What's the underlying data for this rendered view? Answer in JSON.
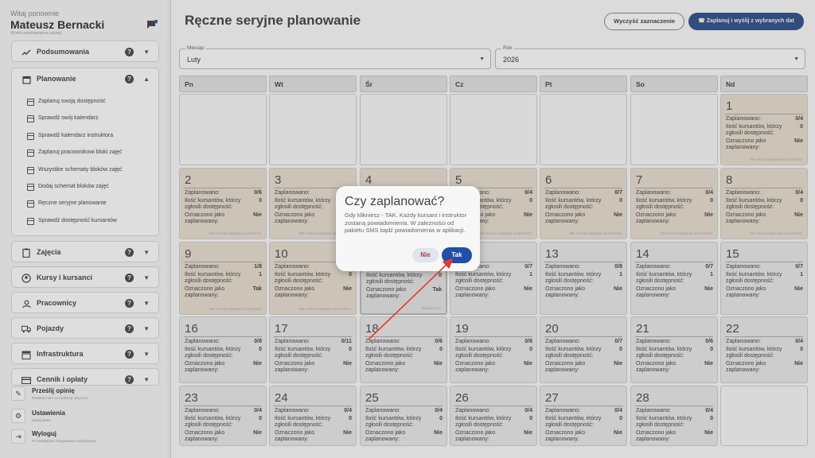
{
  "sidebar": {
    "welcome": "Witaj ponownie",
    "user_name": "Mateusz Bernacki",
    "user_role": "(Konto administratora szkoły)",
    "chat_badge": "0",
    "sections": [
      {
        "label": "Podsumowania",
        "icon": "trending-up-icon",
        "expanded": false
      },
      {
        "label": "Planowanie",
        "icon": "calendar-icon",
        "expanded": true
      },
      {
        "label": "Zajęcia",
        "icon": "clipboard-icon",
        "expanded": false
      },
      {
        "label": "Kursy i kursanci",
        "icon": "person-circle-icon",
        "expanded": false
      },
      {
        "label": "Pracownicy",
        "icon": "person-icon",
        "expanded": false
      },
      {
        "label": "Pojazdy",
        "icon": "truck-icon",
        "expanded": false
      },
      {
        "label": "Infrastruktura",
        "icon": "building-icon",
        "expanded": false
      },
      {
        "label": "Cennik i opłaty",
        "icon": "credit-card-icon",
        "expanded": false
      }
    ],
    "help_glyph": "?",
    "planning_items": [
      "Zaplanuj swoją dostępność",
      "Sprawdź swój kalendarz",
      "Sprawdź kalendarz instruktora",
      "Zaplanuj pracownikowi bloki zajęć",
      "Wszystkie schematy bloków zajęć",
      "Dodaj schemat bloków zajęć",
      "Ręczne seryjne planowanie",
      "Sprawdź dostępność kursantów"
    ],
    "footer": [
      {
        "title": "Prześlij opinię",
        "subtitle": "Powiedz nam co możemy ulepszyć"
      },
      {
        "title": "Ustawienia",
        "subtitle": "Edytuj dane"
      },
      {
        "title": "Wyloguj",
        "subtitle": "Po następnym zalogowaniu wylogowany"
      }
    ]
  },
  "header": {
    "title": "Ręczne seryjne planowanie",
    "clear_button": "Wyczyść zaznaczenie",
    "plan_button": "Zaplanuj i wyślij z wybranych dat"
  },
  "filters": {
    "month_label": "Miesiąc",
    "month_value": "Luty",
    "year_label": "Rok",
    "year_value": "2026"
  },
  "weekdays": [
    "Pn",
    "Wt",
    "Śr",
    "Cz",
    "Pt",
    "So",
    "Nd"
  ],
  "cell_labels": {
    "planned": "Zaplanowano:",
    "students": "Ilość kursantów, którzy zgłosili dostępność:",
    "marked": "Oznaczono jako zaplanowany:"
  },
  "days": [
    {
      "n": "1",
      "planned": "0/4",
      "students": "0",
      "marked": "Nie",
      "note": "Nie można edytować przeszłości",
      "state": "past"
    },
    {
      "n": "2",
      "planned": "0/6",
      "students": "0",
      "marked": "Nie",
      "note": "Nie można edytować przeszłości",
      "state": "past"
    },
    {
      "n": "3",
      "planned": "0/4",
      "students": "0",
      "marked": "Nie",
      "note": "Nie można edytować przeszłości",
      "state": "past"
    },
    {
      "n": "4",
      "planned": "0/4",
      "students": "0",
      "marked": "Nie",
      "note": "Nie można edytować przeszłości",
      "state": "past"
    },
    {
      "n": "5",
      "planned": "0/4",
      "students": "0",
      "marked": "Nie",
      "note": "Nie można edytować przeszłości",
      "state": "past"
    },
    {
      "n": "6",
      "planned": "0/7",
      "students": "0",
      "marked": "Nie",
      "note": "Nie można edytować przeszłości",
      "state": "past"
    },
    {
      "n": "7",
      "planned": "0/4",
      "students": "0",
      "marked": "Nie",
      "note": "Nie można edytować przeszłości",
      "state": "past"
    },
    {
      "n": "8",
      "planned": "0/4",
      "students": "0",
      "marked": "Nie",
      "note": "Nie można edytować przeszłości",
      "state": "past"
    },
    {
      "n": "9",
      "planned": "1/8",
      "students": "1",
      "marked": "Tak",
      "note": "Nie można edytować przeszłości",
      "state": "past"
    },
    {
      "n": "10",
      "planned": "0/4",
      "students": "0",
      "marked": "Nie",
      "note": "Nie można edytować przeszłości",
      "state": "past"
    },
    {
      "n": "11",
      "planned": "0/4",
      "students": "0",
      "marked": "Tak",
      "note": "Zaznaczono",
      "state": "selected"
    },
    {
      "n": "12",
      "planned": "0/7",
      "students": "1",
      "marked": "Nie",
      "note": "",
      "state": "normal"
    },
    {
      "n": "13",
      "planned": "0/8",
      "students": "1",
      "marked": "Nie",
      "note": "",
      "state": "normal"
    },
    {
      "n": "14",
      "planned": "0/7",
      "students": "1",
      "marked": "Nie",
      "note": "",
      "state": "normal"
    },
    {
      "n": "15",
      "planned": "0/7",
      "students": "1",
      "marked": "Nie",
      "note": "",
      "state": "normal"
    },
    {
      "n": "16",
      "planned": "0/8",
      "students": "0",
      "marked": "Nie",
      "note": "",
      "state": "normal"
    },
    {
      "n": "17",
      "planned": "0/11",
      "students": "0",
      "marked": "Nie",
      "note": "",
      "state": "normal"
    },
    {
      "n": "18",
      "planned": "0/6",
      "students": "0",
      "marked": "Nie",
      "note": "",
      "state": "normal"
    },
    {
      "n": "19",
      "planned": "0/6",
      "students": "0",
      "marked": "Nie",
      "note": "",
      "state": "normal"
    },
    {
      "n": "20",
      "planned": "0/7",
      "students": "0",
      "marked": "Nie",
      "note": "",
      "state": "normal"
    },
    {
      "n": "21",
      "planned": "0/6",
      "students": "0",
      "marked": "Nie",
      "note": "",
      "state": "normal"
    },
    {
      "n": "22",
      "planned": "0/4",
      "students": "0",
      "marked": "Nie",
      "note": "",
      "state": "normal"
    },
    {
      "n": "23",
      "planned": "0/4",
      "students": "0",
      "marked": "Nie",
      "note": "",
      "state": "normal"
    },
    {
      "n": "24",
      "planned": "0/4",
      "students": "0",
      "marked": "Nie",
      "note": "",
      "state": "normal"
    },
    {
      "n": "25",
      "planned": "0/4",
      "students": "0",
      "marked": "Nie",
      "note": "",
      "state": "normal"
    },
    {
      "n": "26",
      "planned": "0/4",
      "students": "0",
      "marked": "Nie",
      "note": "",
      "state": "normal"
    },
    {
      "n": "27",
      "planned": "0/4",
      "students": "0",
      "marked": "Nie",
      "note": "",
      "state": "normal"
    },
    {
      "n": "28",
      "planned": "0/4",
      "students": "0",
      "marked": "Nie",
      "note": "",
      "state": "normal"
    }
  ],
  "dialog": {
    "title": "Czy zaplanować?",
    "message": "Gdy klikniesz - TAK. Każdy kursant i instruktor zostaną powiadomienia. W zależności od pakietu SMS bądź powiadomienia w aplikacji.",
    "no_button": "Nie",
    "yes_button": "Tak"
  },
  "colors": {
    "accent": "#21407a",
    "past_cell": "#d8cdbf",
    "annotation_arrow": "#e53935"
  }
}
